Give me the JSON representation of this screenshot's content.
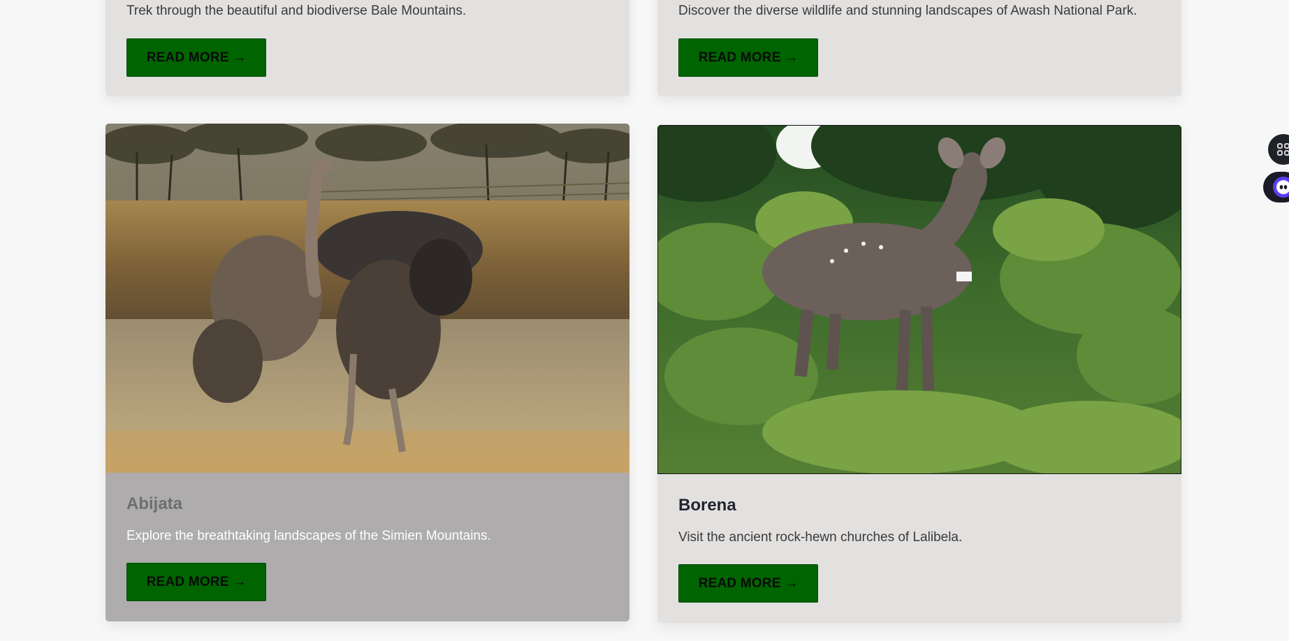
{
  "cards": [
    {
      "title": "",
      "description": "Trek through the beautiful and biodiverse Bale Mountains.",
      "button_label": "READ MORE →"
    },
    {
      "title": "",
      "description": "Discover the diverse wildlife and stunning landscapes of Awash National Park.",
      "button_label": "READ MORE →"
    },
    {
      "title": "Abijata",
      "description": "Explore the breathtaking landscapes of the Simien Mountains.",
      "button_label": "READ MORE →",
      "image_icon": "ostrich-photo",
      "hovered": true
    },
    {
      "title": "Borena",
      "description": "Visit the ancient rock-hewn churches of Lalibela.",
      "button_label": "READ MORE →",
      "image_icon": "mountain-nyala-photo"
    }
  ],
  "floating_widgets": [
    {
      "icon": "grid-menu-icon"
    },
    {
      "icon": "assistant-bot-icon"
    }
  ],
  "colors": {
    "page_background": "#f7f7f7",
    "card_background": "#e3e1e0",
    "card_hover_background": "#aeacad",
    "button_background": "#006400",
    "title_color": "#1f2430"
  }
}
